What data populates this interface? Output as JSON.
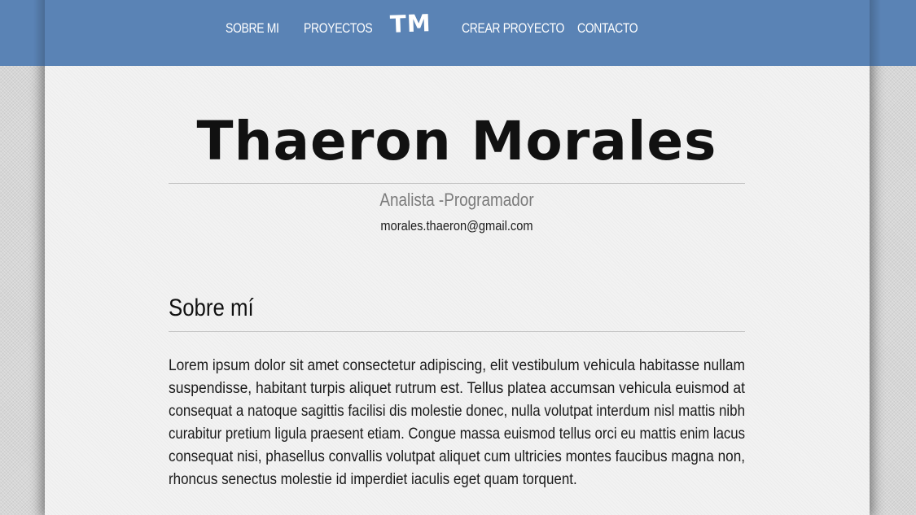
{
  "nav": {
    "items": [
      {
        "label": "SOBRE MI"
      },
      {
        "label": "PROYECTOS"
      },
      {
        "label": "CREAR PROYECTO"
      },
      {
        "label": "CONTACTO"
      }
    ],
    "logo": "TM"
  },
  "header": {
    "name": "Thaeron Morales",
    "role": "Analista -Programador",
    "email": "morales.thaeron@gmail.com"
  },
  "about": {
    "title": "Sobre mí",
    "lines": [
      "Lorem ipsum dolor sit amet consectetur adipiscing, elit vestibulum vehicula habitasse nullam",
      "suspendisse, habitant turpis aliquet rutrum est. Tellus platea accumsan vehicula euismod at",
      "consequat a natoque sagittis facilisi dis molestie donec, nulla volutpat interdum nisl mattis nibh",
      "curabitur pretium ligula praesent etiam. Congue massa euismod tellus orci eu mattis enim lacus",
      "consequat nisi, phasellus convallis volutpat aliquet cum ultricies montes faucibus magna non,",
      "rhoncus senectus molestie id imperdiet iaculis eget quam torquent."
    ]
  },
  "colors": {
    "navbar": "#5a83b5",
    "page": "#f2f2f2",
    "background": "#d6d6d6"
  }
}
